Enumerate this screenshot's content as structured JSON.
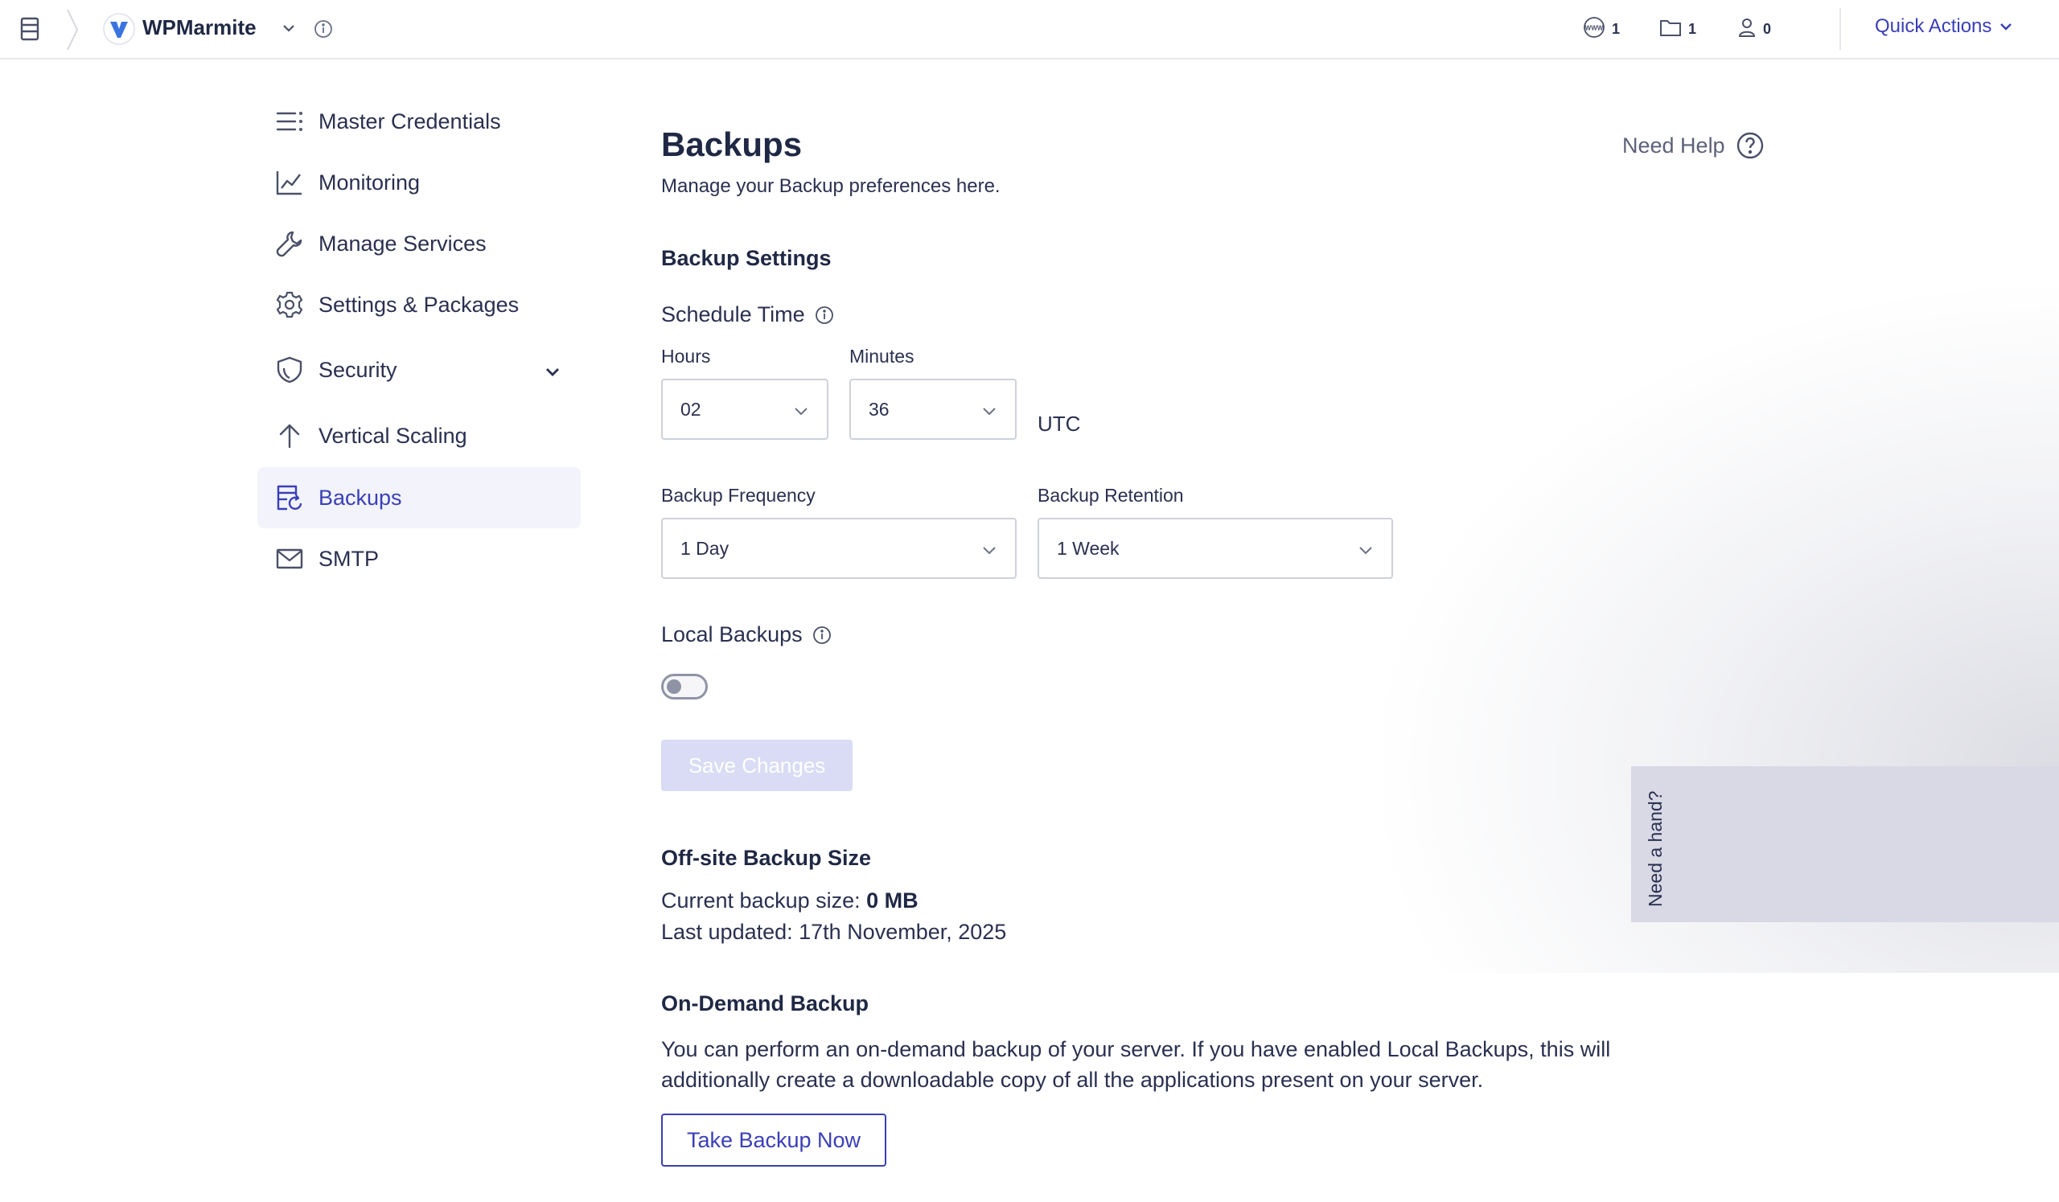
{
  "topbar": {
    "app_name": "WPMarmite",
    "stats": [
      {
        "icon": "www-icon",
        "value": "1"
      },
      {
        "icon": "folder-icon",
        "value": "1"
      },
      {
        "icon": "user-icon",
        "value": "0"
      }
    ],
    "quick_actions_label": "Quick Actions"
  },
  "sidebar": {
    "items": [
      {
        "label": "Master Credentials",
        "icon": "list-icon"
      },
      {
        "label": "Monitoring",
        "icon": "chart-line-icon"
      },
      {
        "label": "Manage Services",
        "icon": "wrench-icon"
      },
      {
        "label": "Settings & Packages",
        "icon": "gear-icon"
      },
      {
        "label": "Security",
        "icon": "shield-icon"
      },
      {
        "label": "Vertical Scaling",
        "icon": "arrow-up-icon"
      },
      {
        "label": "Backups",
        "icon": "backup-icon",
        "active": true
      },
      {
        "label": "SMTP",
        "icon": "mail-icon"
      }
    ]
  },
  "main": {
    "title": "Backups",
    "subtitle": "Manage your Backup preferences here.",
    "need_help": "Need Help",
    "backup_settings_heading": "Backup Settings",
    "schedule_time_label": "Schedule Time",
    "hours_label": "Hours",
    "hours_value": "02",
    "minutes_label": "Minutes",
    "minutes_value": "36",
    "timezone": "UTC",
    "frequency_label": "Backup Frequency",
    "frequency_value": "1 Day",
    "retention_label": "Backup Retention",
    "retention_value": "1 Week",
    "local_backups_label": "Local Backups",
    "local_backups_enabled": false,
    "save_button": "Save Changes",
    "offsite_heading": "Off-site Backup Size",
    "current_size_label": "Current backup size:",
    "current_size_value": "0 MB",
    "last_updated": "Last updated: 17th November, 2025",
    "on_demand_heading": "On-Demand Backup",
    "on_demand_text": "You can perform an on-demand backup of your server. If you have enabled Local Backups, this will additionally create a downloadable copy of all the applications present on your server.",
    "take_backup_button": "Take Backup Now"
  },
  "help_tab": {
    "label": "Need a hand?"
  },
  "colors": {
    "accent": "#3a3fb7",
    "text": "#2a3050",
    "disabled_button": "#d9dcf4"
  }
}
